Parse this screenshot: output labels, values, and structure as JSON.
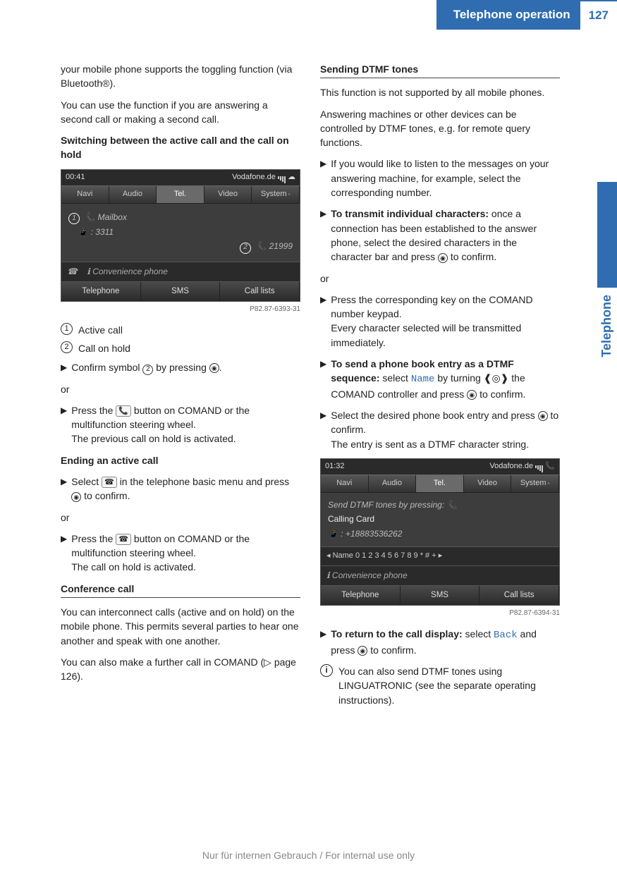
{
  "header": {
    "title": "Telephone operation",
    "page": "127"
  },
  "side_tab": "Telephone",
  "col1": {
    "intro1": "your mobile phone supports the toggling function (via Bluetooth®).",
    "intro2": "You can use the function if you are answering a second call or making a second call.",
    "h_switch": "Switching between the active call and the call on hold",
    "ss1": {
      "time": "00:41",
      "carrier": "Vodafone.de",
      "menu": [
        "Navi",
        "Audio",
        "Tel.",
        "Video",
        "System"
      ],
      "mailbox": "Mailbox",
      "num1": "3311",
      "num2": "21999",
      "conv": "Convenience phone",
      "bottom": [
        "Telephone",
        "SMS",
        "Call lists"
      ],
      "caption": "P82.87-6393-31"
    },
    "legend1": "Active call",
    "legend2": "Call on hold",
    "step_confirm_a": "Confirm symbol ",
    "step_confirm_b": " by pressing ",
    "or": "or",
    "step_press1_a": "Press the ",
    "step_press1_b": " button on COMAND or the multifunction steering wheel.",
    "step_press1_c": "The previous call on hold is activated.",
    "h_end": "Ending an active call",
    "step_end_a": "Select ",
    "step_end_b": " in the telephone basic menu and press ",
    "step_end_c": " to confirm.",
    "step_press2_a": "Press the ",
    "step_press2_b": " button on COMAND or the multifunction steering wheel.",
    "step_press2_c": "The call on hold is activated.",
    "h_conf": "Conference call",
    "conf1": "You can interconnect calls (active and on hold) on the mobile phone. This permits several parties to hear one another and speak with one another.",
    "conf2_a": "You can also make a further call in COMAND (",
    "conf2_b": " page 126)."
  },
  "col2": {
    "h_dtmf": "Sending DTMF tones",
    "p1": "This function is not supported by all mobile phones.",
    "p2": "Answering machines or other devices can be controlled by DTMF tones, e.g. for remote query functions.",
    "step_listen": "If you would like to listen to the messages on your answering machine, for example, select the corresponding number.",
    "step_transmit_label": "To transmit individual characters:",
    "step_transmit_body_a": " once a connection has been established to the answer phone, select the desired characters in the character bar and press ",
    "step_transmit_body_b": " to confirm.",
    "or": "or",
    "step_keypad_a": "Press the corresponding key on the COMAND number keypad.",
    "step_keypad_b": "Every character selected will be transmitted immediately.",
    "step_phonebook_label": "To send a phone book entry as a DTMF sequence:",
    "step_phonebook_a": " select ",
    "step_phonebook_name": "Name",
    "step_phonebook_b": " by turning ",
    "step_phonebook_c": " the COMAND controller and press ",
    "step_phonebook_d": " to confirm.",
    "step_select_a": "Select the desired phone book entry and press ",
    "step_select_b": " to confirm.",
    "step_select_c": "The entry is sent as a DTMF character string.",
    "ss2": {
      "time": "01:32",
      "carrier": "Vodafone.de",
      "menu": [
        "Navi",
        "Audio",
        "Tel.",
        "Video",
        "System"
      ],
      "line1": "Send DTMF tones by pressing:",
      "line2": "Calling Card",
      "line3": "+18883536262",
      "namebar": "Name   0 1 2 3 4 5 6 7 8 9 * # + ",
      "conv": "Convenience phone",
      "bottom": [
        "Telephone",
        "SMS",
        "Call lists"
      ],
      "caption": "P82.87-6394-31"
    },
    "step_return_label": "To return to the call display:",
    "step_return_a": " select ",
    "step_return_back": "Back",
    "step_return_b": " and press ",
    "step_return_c": " to confirm.",
    "info": "You can also send DTMF tones using LINGUATRONIC (see the separate operating instructions)."
  },
  "footer": "Nur für internen Gebrauch / For internal use only"
}
